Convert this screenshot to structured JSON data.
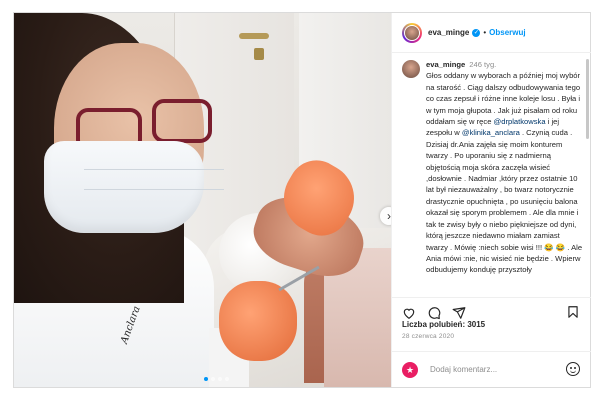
{
  "post": {
    "username": "eva_minge",
    "separator": "•",
    "follow_label": "Obserwuj",
    "caption": {
      "username": "eva_minge",
      "time": "246 tyg.",
      "parts": [
        "Głos oddany w wyborach a później moj wybór na starość . Ciąg dalszy odbudowywania tego co czas zepsuł i różne inne koleje losu . Była i w tym moja głupota . Jak już pisałam od roku oddałam się w ręce ",
        "@drplatkowska",
        " i jej zespołu w ",
        "@klinika_anclara",
        " . Czynią cuda . Dzisiaj dr.Ania zajęła się moim konturem twarzy . Po uporaniu się z nadmierną objętością moja skóra zaczęła wisieć ,dosłownie . Nadmiar ,który przez ostatnie 10 lat był niezauważalny , bo twarz notorycznie drastycznie opuchnięta , po usunięciu balona okazał się sporym problemem . Ale dla mnie i tak te zwisy były o niebo piękniejsze od dyni, którą jeszcze niedawno miałam zamiast twarzy . Mówię :niech sobie wisi !!! 😂 😂 . Ale Ania mówi :nie, nic wisieć nie będzie . Wpierw odbudujemy konduję przysztoły"
      ]
    },
    "likes_label": "Liczba polubień: 3015",
    "date": "28 czerwca 2020",
    "comment_placeholder": "Dodaj komentarz...",
    "photo": {
      "coat_text": "Anclara",
      "carousel_dots": 4,
      "active_dot": 1
    }
  },
  "icons": {
    "next": "chevron-right-icon",
    "like": "heart-icon",
    "comment": "comment-icon",
    "share": "share-icon",
    "save": "bookmark-icon",
    "emoji": "emoji-icon"
  },
  "colors": {
    "accent": "#0095f6",
    "mention": "#00376b",
    "muted": "#8e8e8e",
    "border": "#dbdbdb"
  }
}
